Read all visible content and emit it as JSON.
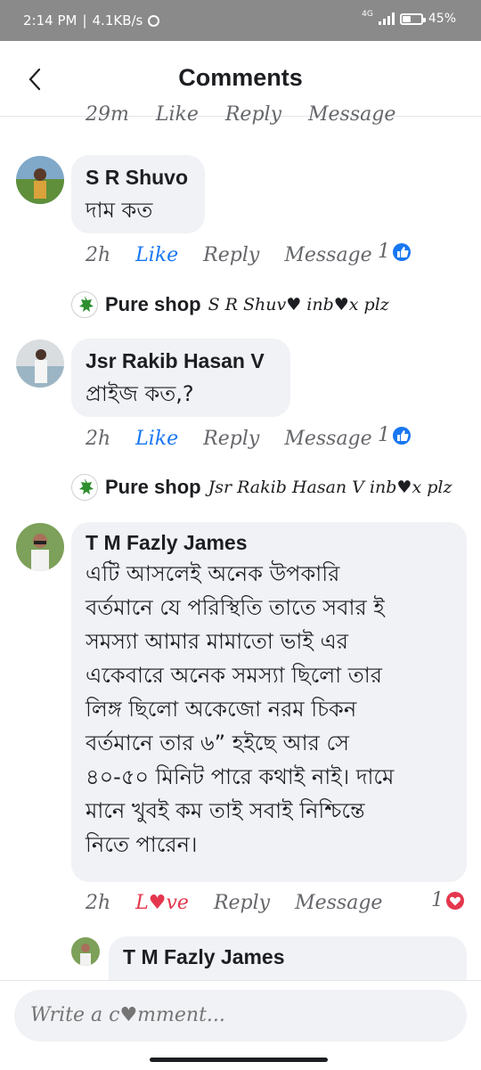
{
  "status_bar": {
    "time": "2:14 PM",
    "speed": "4.1KB/s",
    "network": "4G",
    "battery": "45",
    "battery_level": 0.45
  },
  "header": {
    "title": "Comments"
  },
  "clipped_actions": [
    "29m",
    "Like",
    "Reply",
    "Message"
  ],
  "comments": [
    {
      "name": "S R Shuvo",
      "text": "দাম কত",
      "time": "2h",
      "reaction_label": "Like",
      "reply": "Reply",
      "message": "Message",
      "reaction_count": "1",
      "reply_preview": {
        "author": "Pure shop",
        "text": "S R Shuv♥ inb♥x plz"
      }
    },
    {
      "name": "Jsr Rakib Hasan V",
      "text": "প্রাইজ কত,?",
      "time": "2h",
      "reaction_label": "Like",
      "reply": "Reply",
      "message": "Message",
      "reaction_count": "1",
      "reply_preview": {
        "author": "Pure shop",
        "text": "Jsr Rakib Hasan V inb♥x plz"
      }
    },
    {
      "name": "T M Fazly James",
      "text_lines": [
        "এটি আসলেই অনেক উপকারি",
        "বর্তমানে যে পরিস্থিতি তাতে সবার ই",
        "সমস্যা আমার মামাতো ভাই এর",
        "একেবারে অনেক সমস্যা ছিলো তার",
        "লিঙ্গ ছিলো অকেজো নরম চিকন",
        "বর্তমানে তার ৬” হইছে আর সে",
        "৪০-৫০ মিনিট পারে কথাই নাই। দামে",
        "মানে খুবই কম তাই সবাই নিশ্চিন্তে",
        "নিতে পারেন।"
      ],
      "time": "2h",
      "reaction_label": "L♥ve",
      "reply": "Reply",
      "message": "Message",
      "reaction_count": "1"
    }
  ],
  "nested_reply": {
    "name": "T M Fazly James"
  },
  "composer": {
    "placeholder": "Write a c♥mment..."
  },
  "colors": {
    "like": "#1877f2",
    "love": "#e4374d",
    "bubble": "#f0f2f5",
    "status_bar": "#8a8a8a"
  }
}
